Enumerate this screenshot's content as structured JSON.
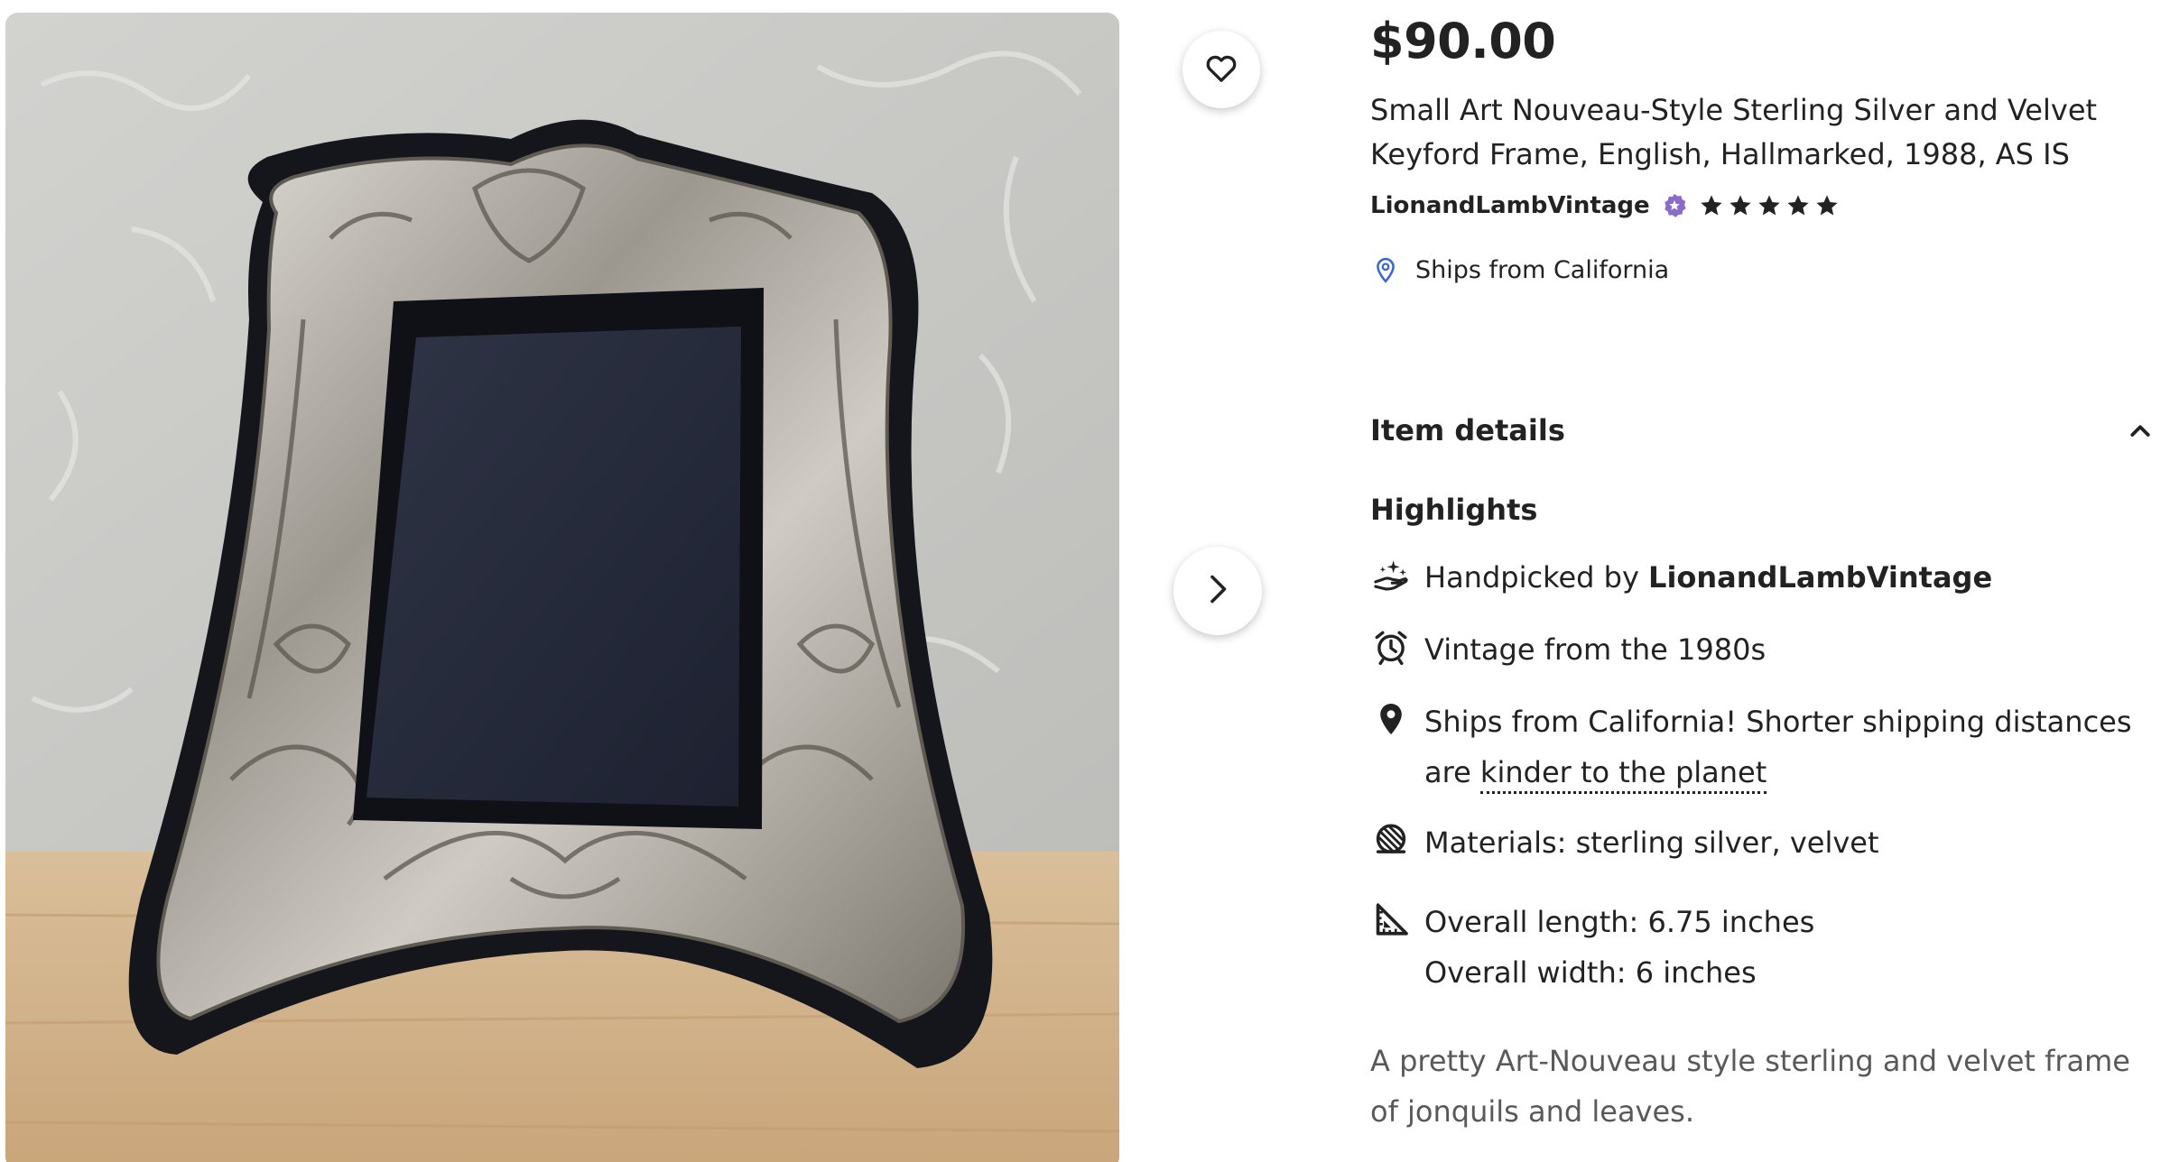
{
  "listing": {
    "price": "$90.00",
    "title": "Small Art Nouveau-Style Sterling Silver and Velvet Keyford Frame, English, Hallmarked, 1988, AS IS",
    "shop_name": "LionandLambVintage",
    "rating_stars": 5,
    "ships_from": "Ships from California"
  },
  "item_details": {
    "heading": "Item details",
    "highlights_heading": "Highlights",
    "handpicked_prefix": "Handpicked by ",
    "handpicked_shop": "LionandLambVintage",
    "vintage": "Vintage from the 1980s",
    "ships_line": "Ships from California! Shorter shipping distances are ",
    "ships_link": "kinder to the planet",
    "materials": "Materials: sterling silver, velvet",
    "length": "Overall length: 6.75 inches",
    "width": "Overall width: 6 inches",
    "description": "A pretty Art-Nouveau style sterling and velvet frame of jonquils and leaves."
  },
  "icons": {
    "favorite": "heart-icon",
    "next": "chevron-right-icon",
    "star_seller": "star-seller-badge-icon",
    "ships": "location-pin-icon",
    "collapse": "chevron-up-icon",
    "handpicked": "hand-sparkle-icon",
    "vintage": "alarm-clock-icon",
    "location": "location-pin-icon",
    "materials": "material-ball-icon",
    "dimensions": "set-square-icon"
  },
  "colors": {
    "text": "#222222",
    "muted": "#595959",
    "star_seller_purple": "#8a6bc9",
    "pin_blue": "#3b67d3"
  }
}
